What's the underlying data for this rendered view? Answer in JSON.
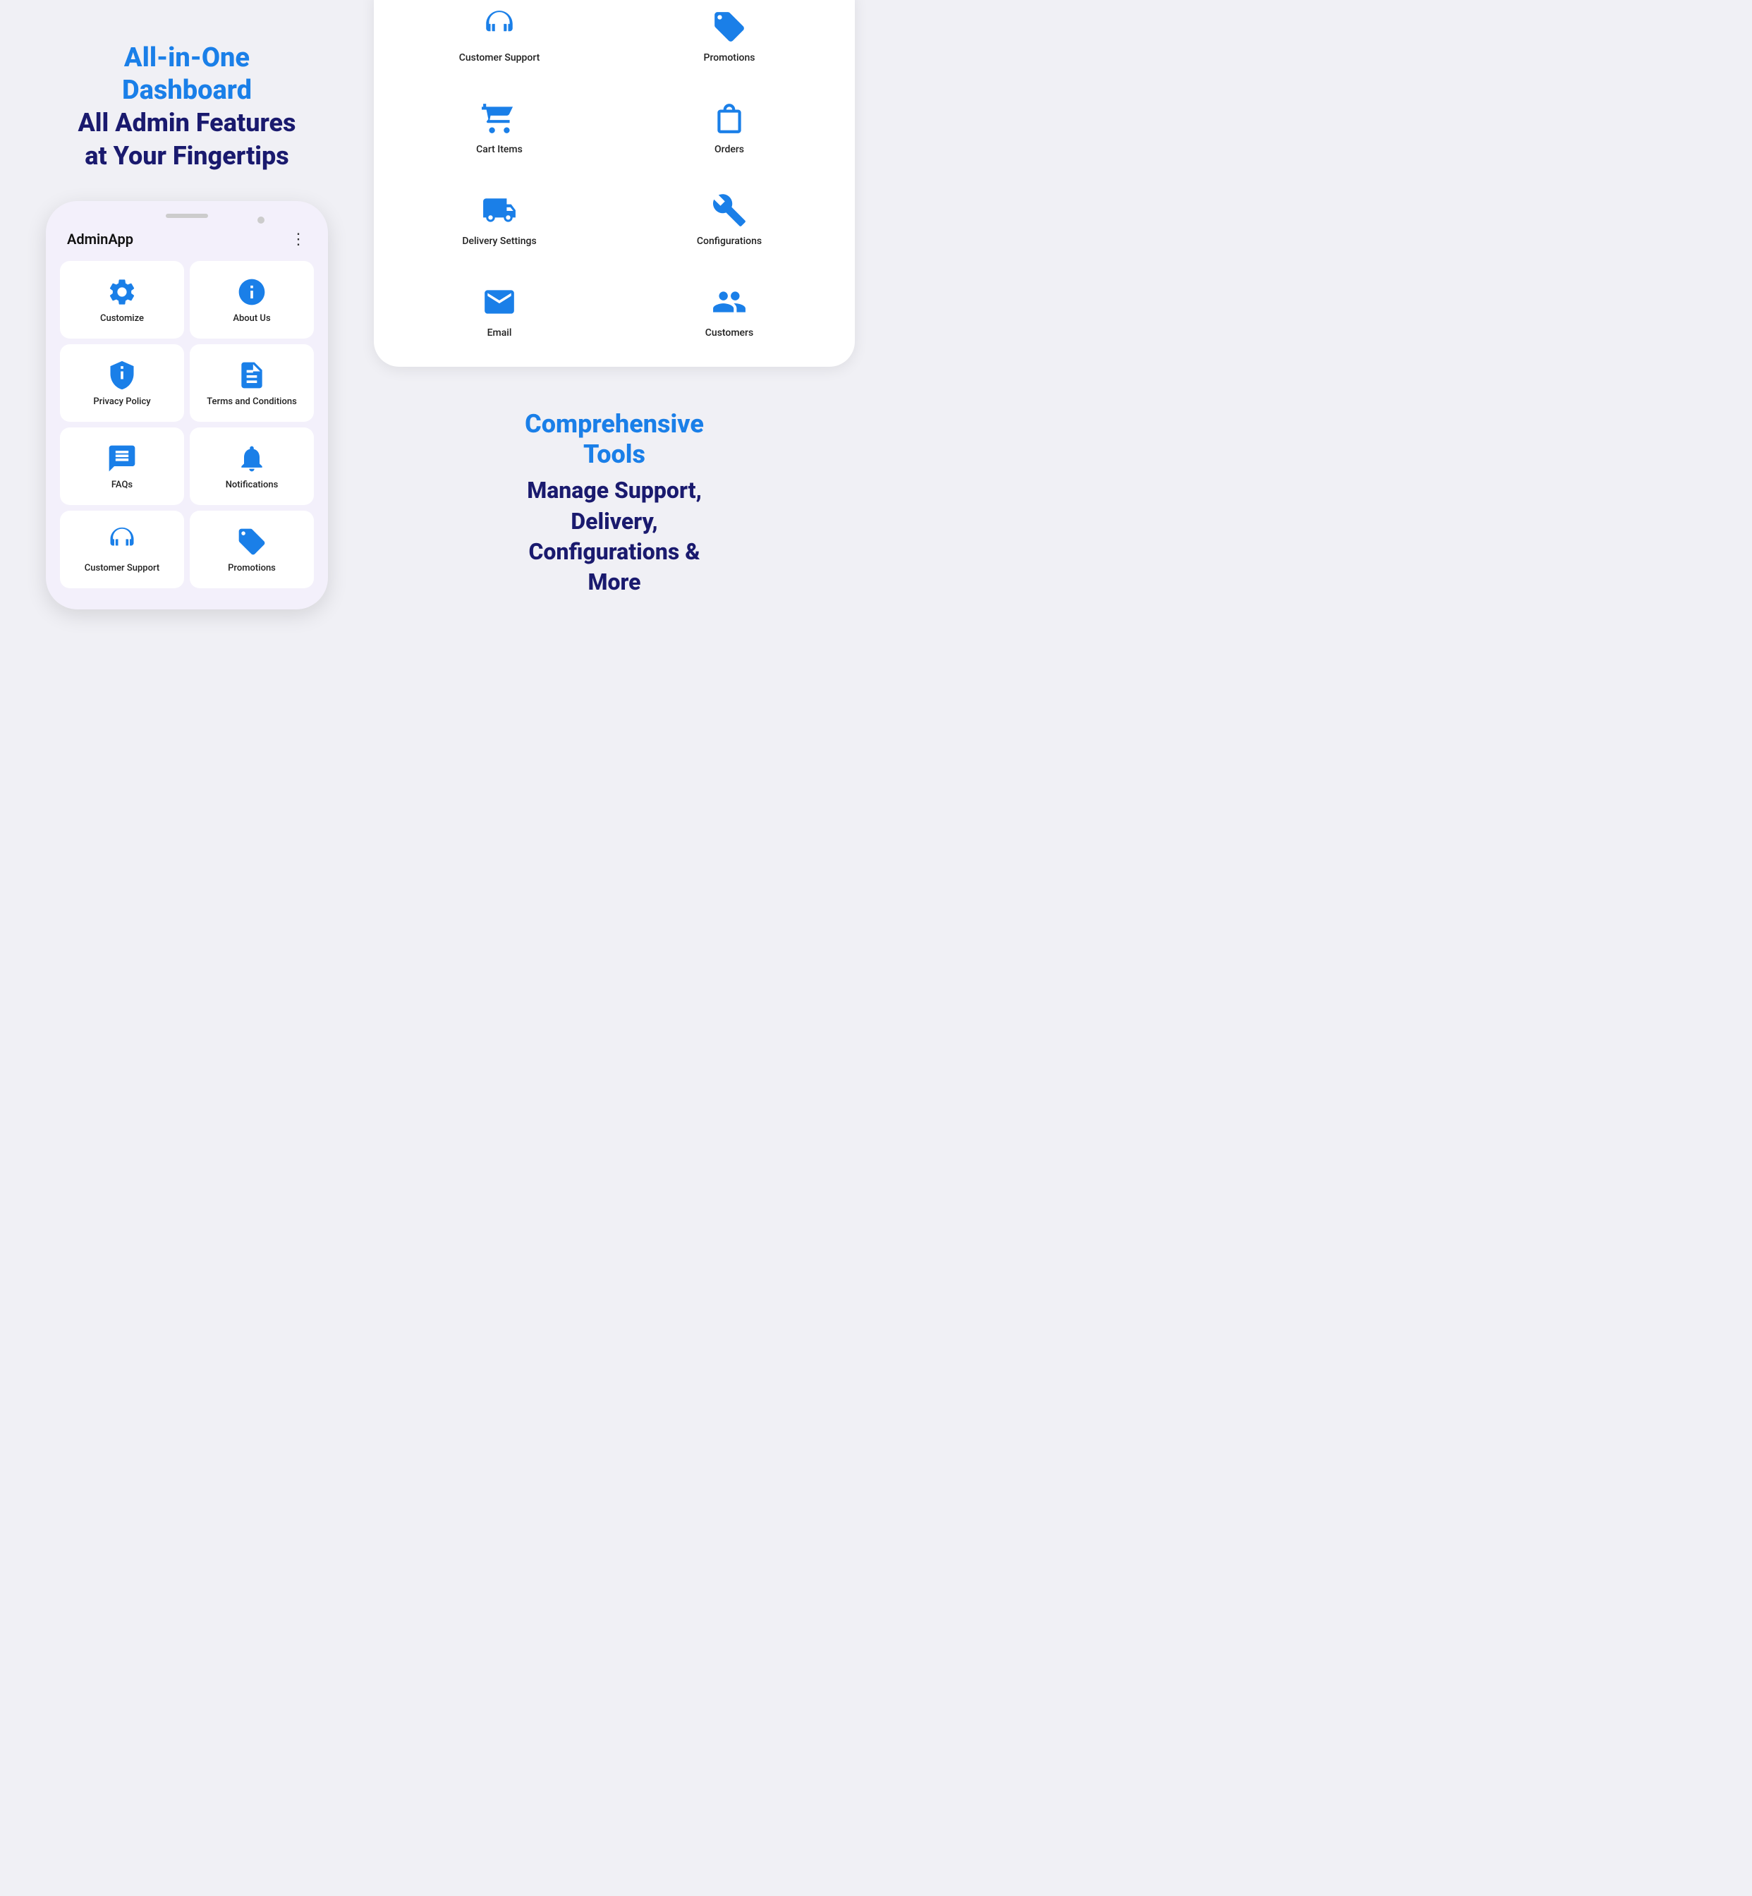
{
  "left": {
    "headline_blue": "All-in-One\nDashboard",
    "headline_dark": "All Admin Features\nat Your Fingertips",
    "app_title": "AdminApp",
    "grid_items": [
      {
        "id": "customize",
        "label": "Customize",
        "icon": "gear"
      },
      {
        "id": "about-us",
        "label": "About Us",
        "icon": "info"
      },
      {
        "id": "privacy-policy",
        "label": "Privacy Policy",
        "icon": "shield"
      },
      {
        "id": "terms",
        "label": "Terms and Conditions",
        "icon": "document"
      },
      {
        "id": "faqs",
        "label": "FAQs",
        "icon": "chat"
      },
      {
        "id": "notifications",
        "label": "Notifications",
        "icon": "bell"
      },
      {
        "id": "customer-support",
        "label": "Customer Support",
        "icon": "headset"
      },
      {
        "id": "promotions",
        "label": "Promotions",
        "icon": "tag"
      }
    ]
  },
  "right": {
    "top_items": [
      {
        "id": "customer-support",
        "label": "Customer Support",
        "icon": "headset"
      },
      {
        "id": "promotions",
        "label": "Promotions",
        "icon": "tag"
      },
      {
        "id": "cart-items",
        "label": "Cart Items",
        "icon": "cart"
      },
      {
        "id": "orders",
        "label": "Orders",
        "icon": "bag"
      },
      {
        "id": "delivery-settings",
        "label": "Delivery Settings",
        "icon": "truck"
      },
      {
        "id": "configurations",
        "label": "Configurations",
        "icon": "wrench"
      },
      {
        "id": "email",
        "label": "Email",
        "icon": "email"
      },
      {
        "id": "customers",
        "label": "Customers",
        "icon": "customers"
      }
    ],
    "bottom_blue": "Comprehensive\nTools",
    "bottom_dark": "Manage Support,\nDelivery,\nConfigurations &\nMore"
  }
}
